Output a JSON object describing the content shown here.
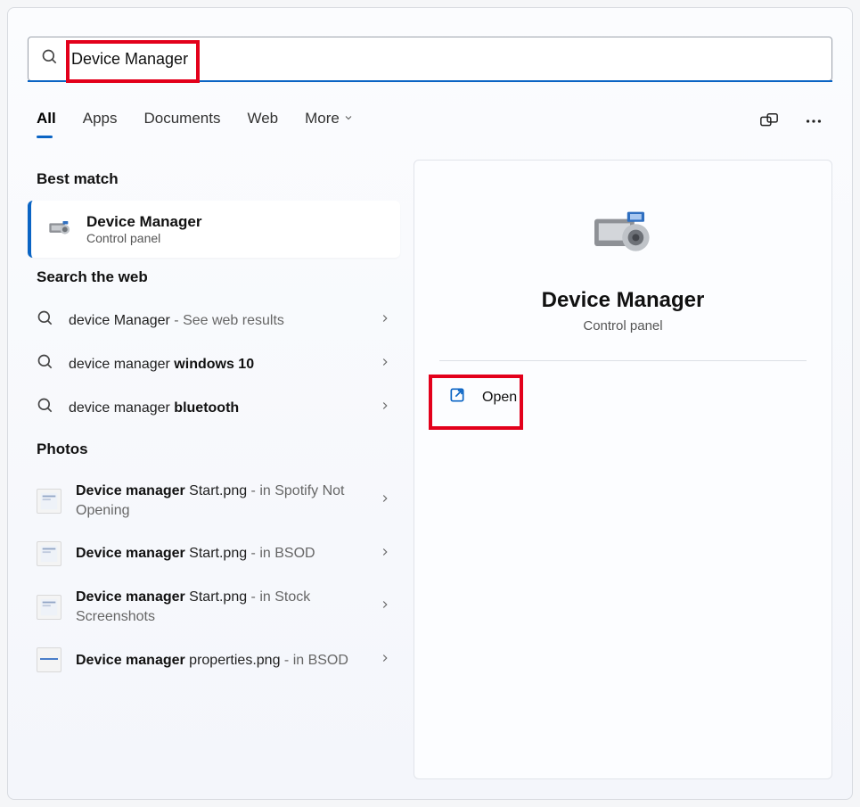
{
  "search": {
    "value": "Device Manager"
  },
  "tabs": {
    "all": "All",
    "apps": "Apps",
    "documents": "Documents",
    "web": "Web",
    "more": "More"
  },
  "sections": {
    "best": "Best match",
    "web": "Search the web",
    "photos": "Photos"
  },
  "best": {
    "title": "Device Manager",
    "sub": "Control panel"
  },
  "webResults": {
    "r0": {
      "prefix": "device Manager",
      "suffix": " - See web results"
    },
    "r1": {
      "prefix": "device manager ",
      "bold": "windows 10"
    },
    "r2": {
      "prefix": "device manager ",
      "bold": "bluetooth"
    }
  },
  "photos": {
    "p0": {
      "bold": "Device manager",
      "rest": " Start.png",
      "tail": " - in Spotify Not Opening"
    },
    "p1": {
      "bold": "Device manager",
      "rest": " Start.png",
      "tail": " - in BSOD"
    },
    "p2": {
      "bold": "Device manager",
      "rest": " Start.png",
      "tail": " - in Stock Screenshots"
    },
    "p3": {
      "bold": "Device manager",
      "rest": " properties.png",
      "tail": " - in BSOD"
    }
  },
  "preview": {
    "title": "Device Manager",
    "sub": "Control panel",
    "open": "Open"
  }
}
